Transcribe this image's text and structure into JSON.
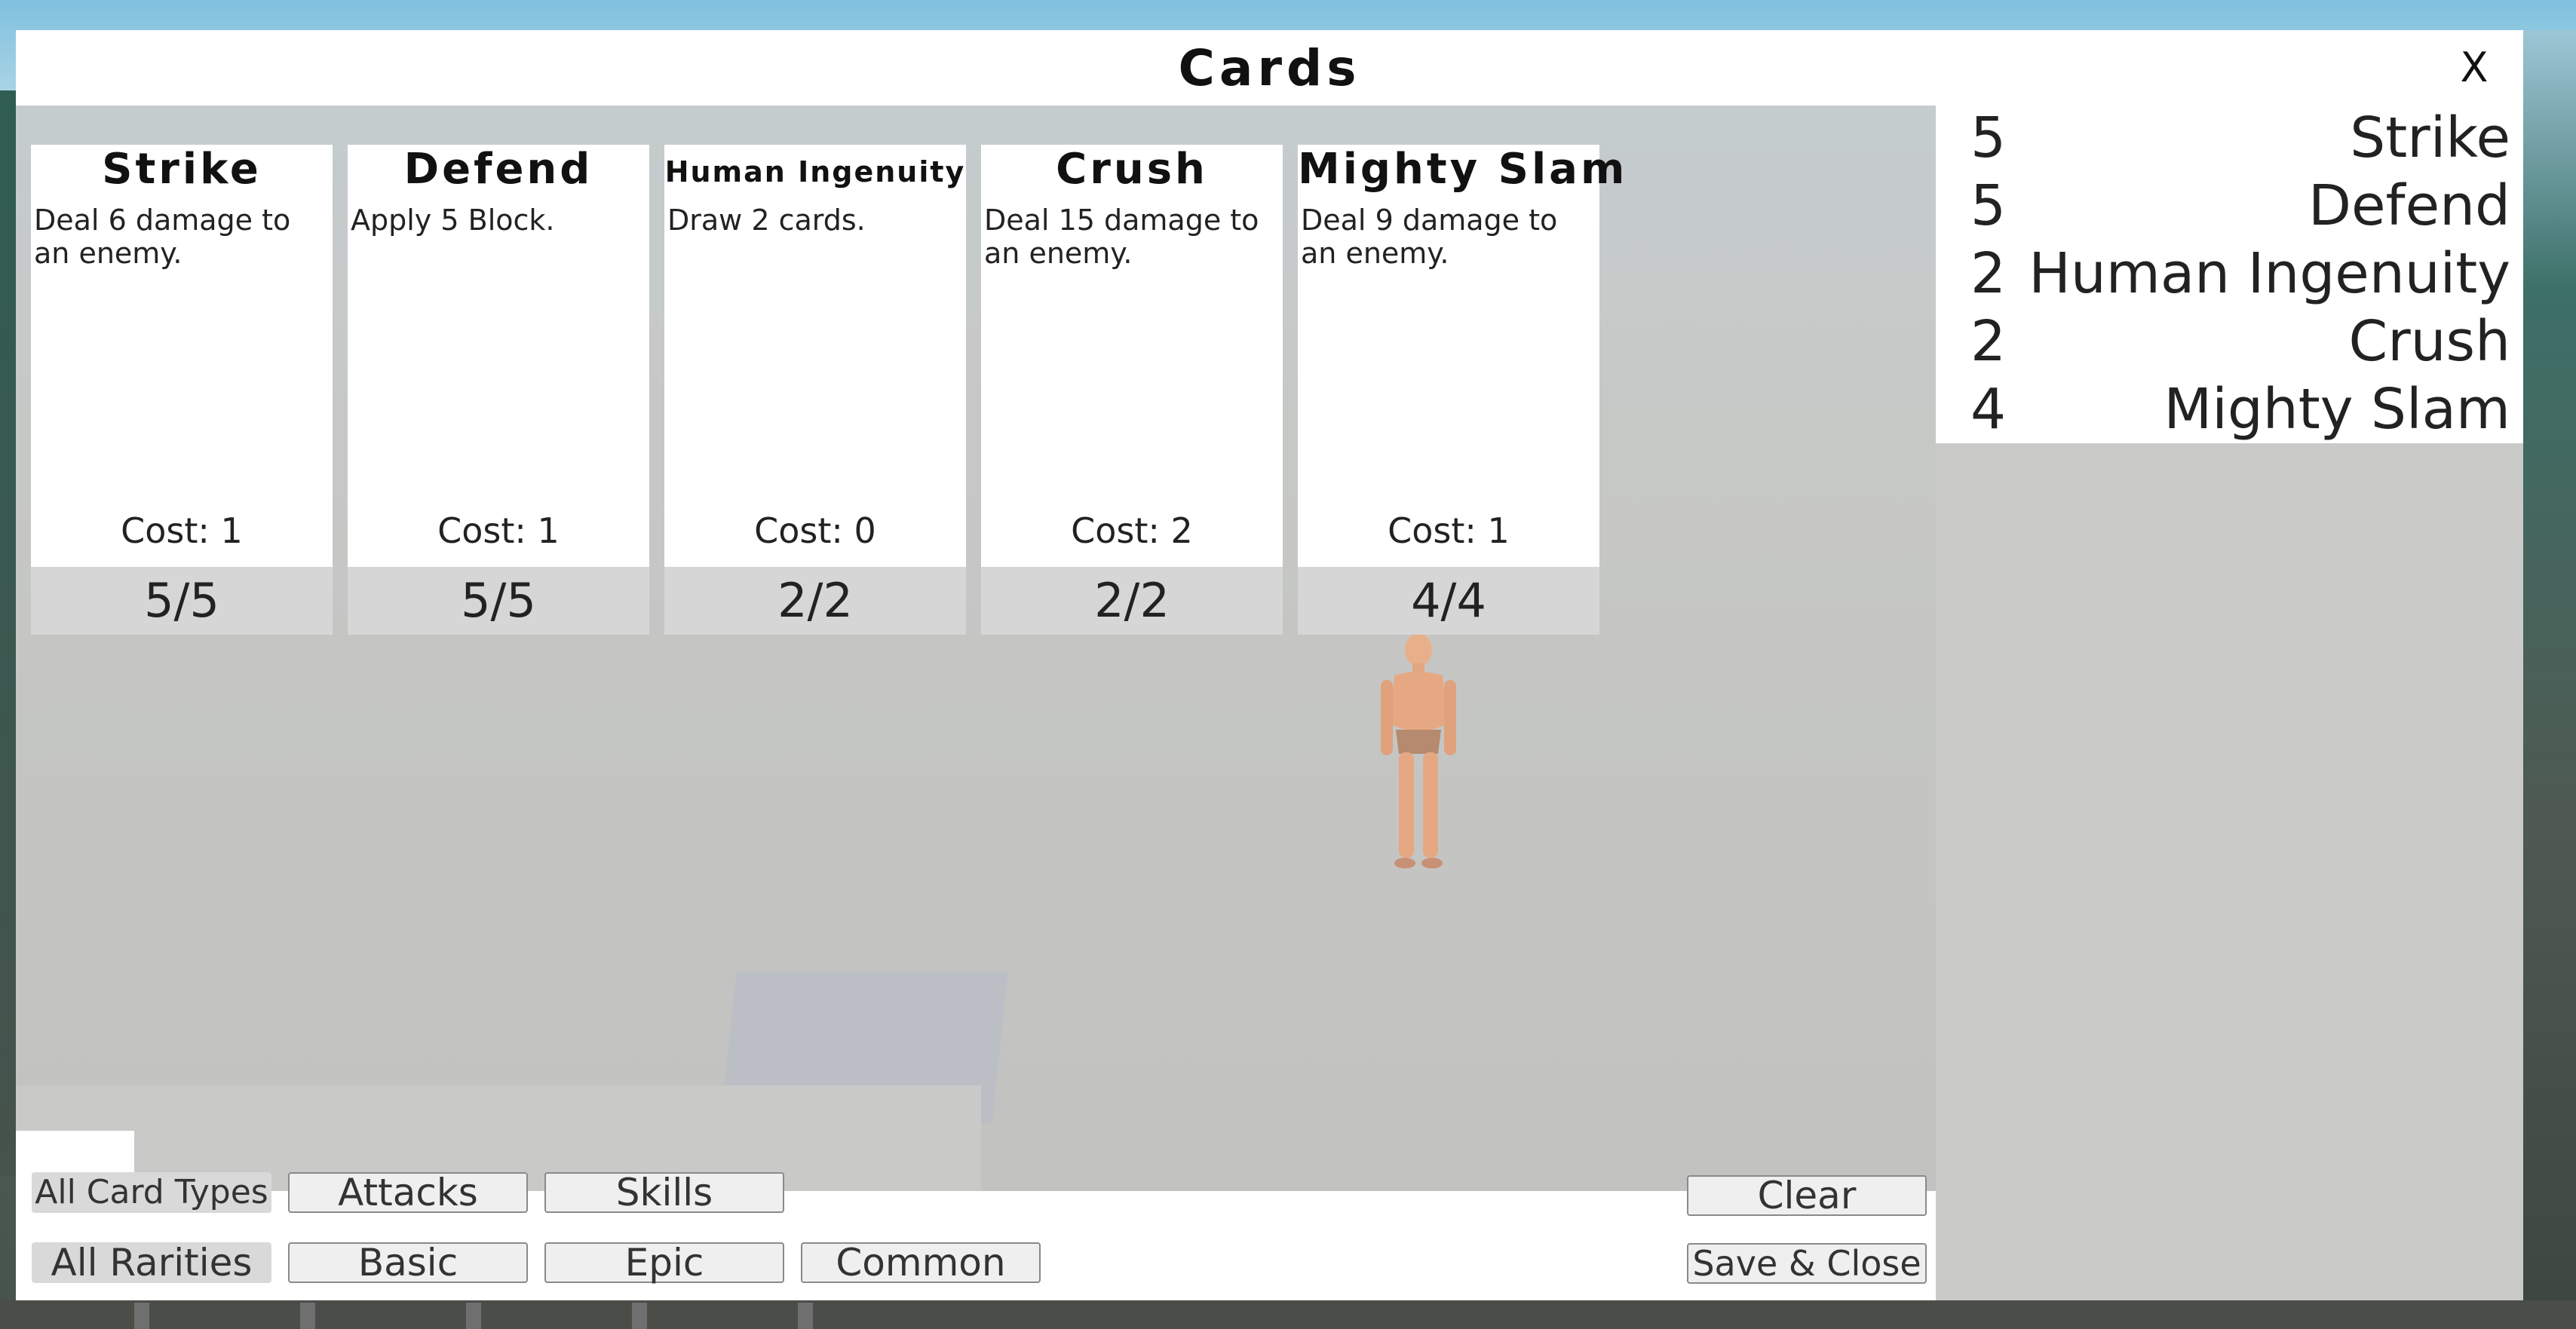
{
  "window": {
    "title": "Cards",
    "close_label": "X"
  },
  "cards": [
    {
      "name": "Strike",
      "description": "Deal 6 damage to an enemy.",
      "cost": "Cost: 1",
      "count": "5/5"
    },
    {
      "name": "Defend",
      "description": "Apply 5 Block.",
      "cost": "Cost: 1",
      "count": "5/5"
    },
    {
      "name": "Human Ingenuity",
      "description": "Draw 2 cards.",
      "cost": "Cost: 0",
      "count": "2/2"
    },
    {
      "name": "Crush",
      "description": "Deal 15 damage to an enemy.",
      "cost": "Cost: 2",
      "count": "2/2"
    },
    {
      "name": "Mighty Slam",
      "description": "Deal 9 damage to an enemy.",
      "cost": "Cost: 1",
      "count": "4/4"
    }
  ],
  "deck": [
    {
      "qty": "5",
      "name": "Strike"
    },
    {
      "qty": "5",
      "name": "Defend"
    },
    {
      "qty": "2",
      "name": "Human Ingenuity"
    },
    {
      "qty": "2",
      "name": "Crush"
    },
    {
      "qty": "4",
      "name": "Mighty Slam"
    }
  ],
  "filters": {
    "types": [
      "All Card Types",
      "Attacks",
      "Skills"
    ],
    "rarities": [
      "All Rarities",
      "Basic",
      "Epic",
      "Common"
    ]
  },
  "actions": {
    "clear": "Clear",
    "save_close": "Save & Close"
  }
}
